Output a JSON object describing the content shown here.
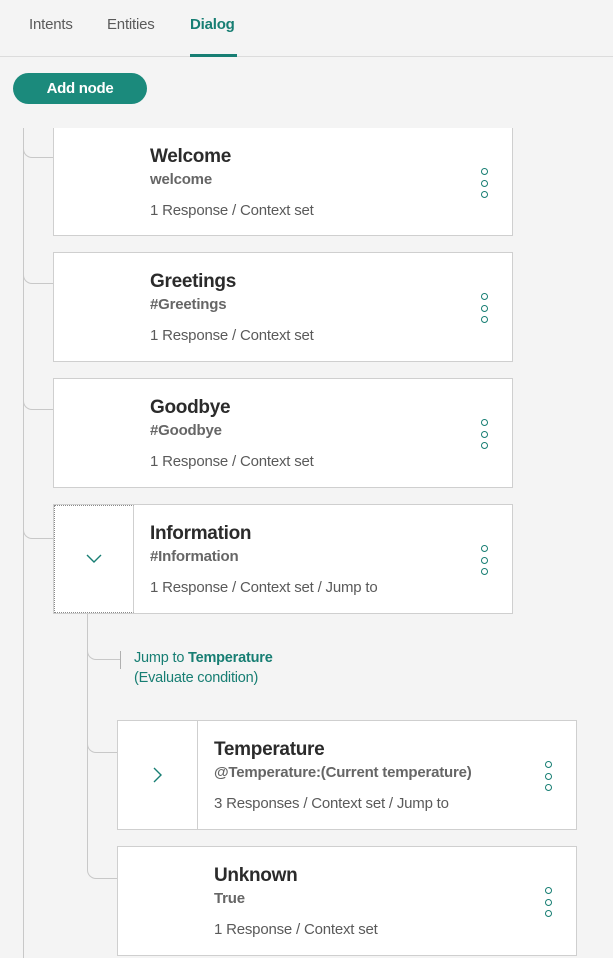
{
  "tabs": [
    {
      "label": "Intents"
    },
    {
      "label": "Entities"
    },
    {
      "label": "Dialog"
    }
  ],
  "toolbar": {
    "add_node_label": "Add node"
  },
  "nodes": [
    {
      "title": "Welcome",
      "condition": "welcome",
      "meta": "1 Response  /  Context set"
    },
    {
      "title": "Greetings",
      "condition": "#Greetings",
      "meta": "1 Response  /  Context set"
    },
    {
      "title": "Goodbye",
      "condition": "#Goodbye",
      "meta": "1 Response  /  Context set"
    },
    {
      "title": "Information",
      "condition": "#Information",
      "meta": "1 Response  /  Context set  /  Jump to"
    }
  ],
  "jump": {
    "prefix": "Jump to ",
    "target": "Temperature",
    "note": "(Evaluate condition)"
  },
  "children": [
    {
      "title": "Temperature",
      "condition": "@Temperature:(Current temperature)",
      "meta": "3 Responses  /  Context set  /  Jump to"
    },
    {
      "title": "Unknown",
      "condition": "True",
      "meta": "1 Response  /  Context set"
    }
  ],
  "icons": {
    "collapse": "chevron-down-icon",
    "expand": "chevron-right-icon",
    "menu": "overflow-menu-icon"
  },
  "colors": {
    "accent": "#177e73",
    "button": "#1b8a7c"
  }
}
